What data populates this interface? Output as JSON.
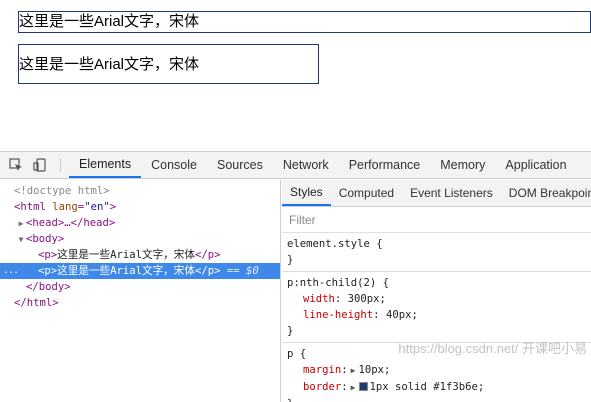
{
  "page": {
    "para1_text": "这里是一些Arial文字，宋体",
    "para2_text": "这里是一些Arial文字，宋体"
  },
  "toolbar": {
    "tabs": [
      "Elements",
      "Console",
      "Sources",
      "Network",
      "Performance",
      "Memory",
      "Application"
    ]
  },
  "elements": {
    "doctype": "<!doctype html>",
    "html_open_tag": "<html ",
    "html_attr_name": "lang",
    "html_attr_eq": "=",
    "html_attr_value": "\"en\"",
    "html_open_close": ">",
    "head_line": "<head>…</head>",
    "body_open": "<body>",
    "p1_open": "<p>",
    "p1_text": "这里是一些Arial文字，宋体",
    "p1_close": "</p>",
    "p2_open": "<p>",
    "p2_text": "这里是一些Arial文字，宋体",
    "p2_close": "</p>",
    "selected_marker": "== $0",
    "dots": "...",
    "body_close": "</body>",
    "html_close": "</html>"
  },
  "styles": {
    "tabs": [
      "Styles",
      "Computed",
      "Event Listeners",
      "DOM Breakpoints"
    ],
    "filter_placeholder": "Filter",
    "rules": [
      {
        "selector": "element.style {",
        "props": [],
        "close": "}"
      },
      {
        "selector": "p:nth-child(2) {",
        "props": [
          {
            "name": "width",
            "value": "300px;"
          },
          {
            "name": "line-height",
            "value": "40px;"
          }
        ],
        "close": "}"
      },
      {
        "selector": "p {",
        "props": [
          {
            "name": "margin",
            "value": "10px;"
          },
          {
            "name": "border",
            "value": "1px solid #1f3b6e;"
          }
        ],
        "close": "}"
      }
    ]
  },
  "watermark": "https://blog.csdn.net/ 开课吧小易",
  "colors": {
    "accent": "#1a73e8",
    "selected_row": "#3d88e9",
    "border_color": "#1f3b6e"
  }
}
